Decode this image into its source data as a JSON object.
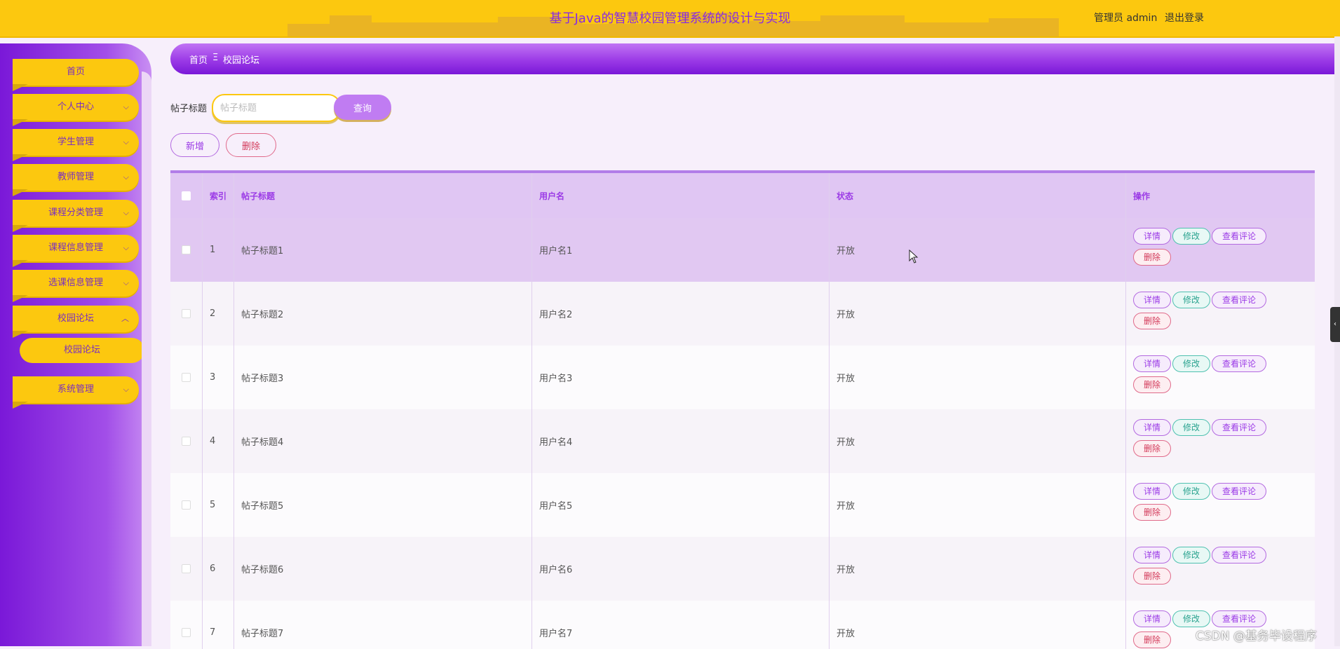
{
  "header": {
    "title": "基于Java的智慧校园管理系统的设计与实现",
    "user_label": "管理员 admin",
    "logout_label": "退出登录"
  },
  "sidebar": {
    "items": [
      {
        "label": "首页",
        "has_chevron": false
      },
      {
        "label": "个人中心",
        "has_chevron": true
      },
      {
        "label": "学生管理",
        "has_chevron": true
      },
      {
        "label": "教师管理",
        "has_chevron": true
      },
      {
        "label": "课程分类管理",
        "has_chevron": true
      },
      {
        "label": "课程信息管理",
        "has_chevron": true
      },
      {
        "label": "选课信息管理",
        "has_chevron": true
      },
      {
        "label": "校园论坛",
        "has_chevron": true,
        "expanded": true
      },
      {
        "label": "系统管理",
        "has_chevron": true
      }
    ],
    "submenu": {
      "label": "校园论坛"
    }
  },
  "breadcrumb": {
    "home": "首页",
    "separator": "Ξ",
    "current": "校园论坛"
  },
  "search": {
    "label": "帖子标题",
    "placeholder": "帖子标题",
    "value": "",
    "button": "查询"
  },
  "toolbar": {
    "add": "新增",
    "delete": "删除"
  },
  "table": {
    "columns": [
      "索引",
      "帖子标题",
      "用户名",
      "状态",
      "操作"
    ],
    "rows": [
      {
        "index": "1",
        "title": "帖子标题1",
        "user": "用户名1",
        "status": "开放",
        "selected": true
      },
      {
        "index": "2",
        "title": "帖子标题2",
        "user": "用户名2",
        "status": "开放"
      },
      {
        "index": "3",
        "title": "帖子标题3",
        "user": "用户名3",
        "status": "开放"
      },
      {
        "index": "4",
        "title": "帖子标题4",
        "user": "用户名4",
        "status": "开放"
      },
      {
        "index": "5",
        "title": "帖子标题5",
        "user": "用户名5",
        "status": "开放"
      },
      {
        "index": "6",
        "title": "帖子标题6",
        "user": "用户名6",
        "status": "开放"
      },
      {
        "index": "7",
        "title": "帖子标题7",
        "user": "用户名7",
        "status": "开放"
      }
    ],
    "actions": {
      "detail": "详情",
      "edit": "修改",
      "comments": "查看评论",
      "remove": "删除"
    }
  },
  "watermark": "CSDN @基务毕设程序",
  "colors": {
    "header_bg": "#fcc80f",
    "accent_purple": "#9b3ae6",
    "title_purple": "#8a2be2"
  }
}
